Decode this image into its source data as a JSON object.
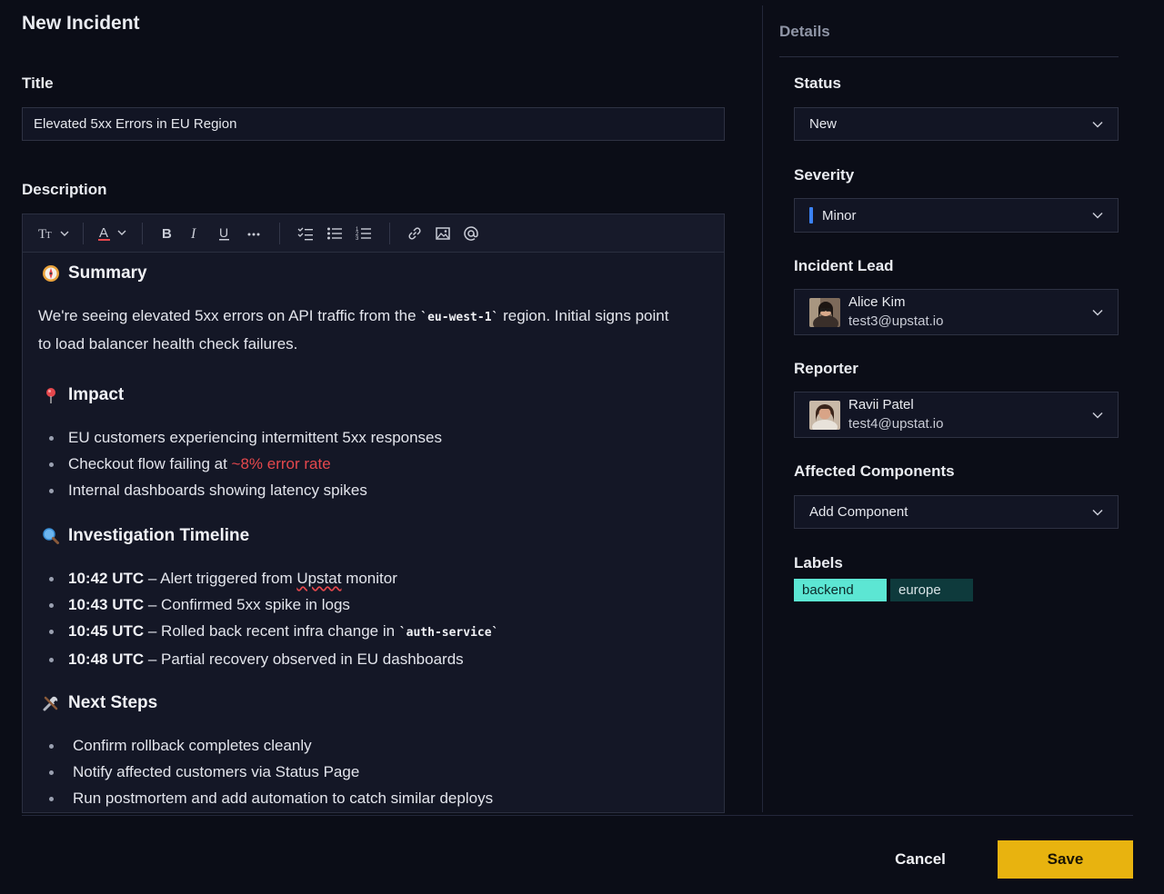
{
  "page": {
    "title": "New Incident"
  },
  "form": {
    "title_label": "Title",
    "title_value": "Elevated 5xx Errors in EU Region",
    "description_label": "Description"
  },
  "toolbar": {
    "text_style_icon": "text-size-icon",
    "items": [
      "text-size-icon",
      "font-color-icon",
      "bold-icon",
      "italic-icon",
      "underline-icon",
      "more-icon",
      "checklist-icon",
      "bullet-list-icon",
      "numbered-list-icon",
      "link-icon",
      "image-icon",
      "mention-icon"
    ]
  },
  "description": {
    "summary": {
      "heading": "Summary",
      "icon": "compass-emoji",
      "text_before": "We're seeing elevated 5xx errors on API traffic from the ",
      "code": "`eu-west-1`",
      "text_after": " region. Initial signs point",
      "text_line2": "to load balancer health check failures."
    },
    "impact": {
      "heading": "Impact",
      "icon": "pushpin-emoji",
      "items": [
        "EU customers experiencing intermittent 5xx responses",
        "Checkout flow failing at ",
        "Internal dashboards showing latency spikes"
      ],
      "highlight": "~8% error rate",
      "highlight_color": "#e5484d"
    },
    "timeline": {
      "heading": "Investigation Timeline",
      "icon": "magnifier-emoji",
      "items": [
        {
          "time": "10:42 UTC",
          "text_before": " – Alert triggered from ",
          "spell": "Upstat",
          "text_after": " monitor"
        },
        {
          "time": "10:43 UTC",
          "text": " – Confirmed 5xx spike in logs"
        },
        {
          "time": "10:45 UTC",
          "text": " – Rolled back recent infra change in ",
          "code": "`auth-service`"
        },
        {
          "time": "10:48 UTC",
          "text": " – Partial recovery observed in EU dashboards"
        }
      ]
    },
    "next_steps": {
      "heading": "Next Steps",
      "icon": "tools-emoji",
      "items": [
        "Confirm rollback completes cleanly",
        "Notify affected customers via Status Page",
        "Run postmortem and add automation to catch similar deploys"
      ]
    }
  },
  "details": {
    "title": "Details",
    "status": {
      "label": "Status",
      "value": "New"
    },
    "severity": {
      "label": "Severity",
      "value": "Minor",
      "color": "#3b82f6"
    },
    "incident_lead": {
      "label": "Incident Lead",
      "name": "Alice Kim",
      "email": "test3@upstat.io"
    },
    "reporter": {
      "label": "Reporter",
      "name": "Ravii Patel",
      "email": "test4@upstat.io"
    },
    "affected_components": {
      "label": "Affected Components",
      "placeholder": "Add Component"
    },
    "labels": {
      "label": "Labels",
      "items": [
        "backend",
        "europe"
      ],
      "colors": [
        "#5ce6d3",
        "#0e3a3c"
      ]
    }
  },
  "footer": {
    "cancel_label": "Cancel",
    "save_label": "Save",
    "save_color": "#e8b30f"
  }
}
